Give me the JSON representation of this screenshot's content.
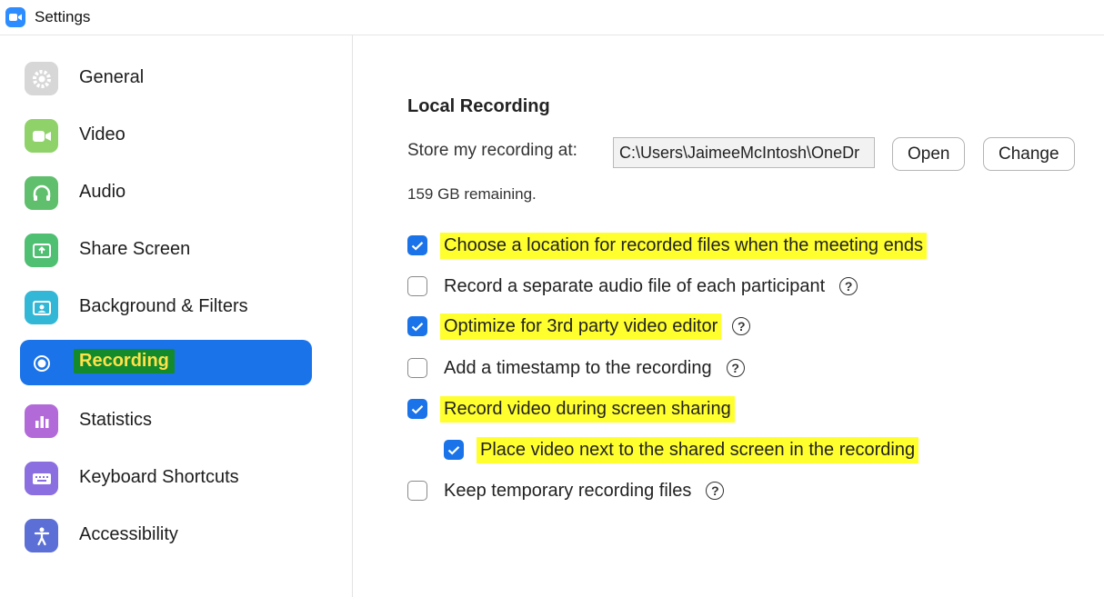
{
  "window": {
    "title": "Settings"
  },
  "sidebar": {
    "items": [
      {
        "label": "General",
        "icon": "gear-icon",
        "color": "#d7d7d7"
      },
      {
        "label": "Video",
        "icon": "video-camera-icon",
        "color": "#8fd26a"
      },
      {
        "label": "Audio",
        "icon": "headphones-icon",
        "color": "#5fbf6c"
      },
      {
        "label": "Share Screen",
        "icon": "share-screen-icon",
        "color": "#4fbf72"
      },
      {
        "label": "Background & Filters",
        "icon": "person-portrait-icon",
        "color": "#32b8d6"
      },
      {
        "label": "Recording",
        "icon": "record-icon",
        "active": true
      },
      {
        "label": "Statistics",
        "icon": "bar-chart-icon",
        "color": "#b36ad9"
      },
      {
        "label": "Keyboard Shortcuts",
        "icon": "keyboard-icon",
        "color": "#8b6ee0"
      },
      {
        "label": "Accessibility",
        "icon": "accessibility-icon",
        "color": "#5b6fd6"
      }
    ]
  },
  "recording": {
    "section_title": "Local Recording",
    "store_label": "Store my recording at:",
    "path_value": "C:\\Users\\JaimeeMcIntosh\\OneDr",
    "open_button": "Open",
    "change_button": "Change",
    "remaining": "159 GB remaining.",
    "options": [
      {
        "label": "Choose a location for recorded files when the meeting ends",
        "checked": true,
        "help": false,
        "highlighted": true
      },
      {
        "label": "Record a separate audio file of each participant",
        "checked": false,
        "help": true,
        "highlighted": false
      },
      {
        "label": "Optimize for 3rd party video editor",
        "checked": true,
        "help": true,
        "highlighted": true
      },
      {
        "label": "Add a timestamp to the recording",
        "checked": false,
        "help": true,
        "highlighted": false
      },
      {
        "label": "Record video during screen sharing",
        "checked": true,
        "help": false,
        "highlighted": true
      },
      {
        "label": "Place video next to the shared screen in the recording",
        "checked": true,
        "help": false,
        "highlighted": true,
        "indent": true
      },
      {
        "label": "Keep temporary recording files",
        "checked": false,
        "help": true,
        "highlighted": false
      }
    ]
  },
  "colors": {
    "accent": "#1a73e8",
    "highlight": "#ffff2e",
    "active_label_bg": "#138a2b"
  }
}
